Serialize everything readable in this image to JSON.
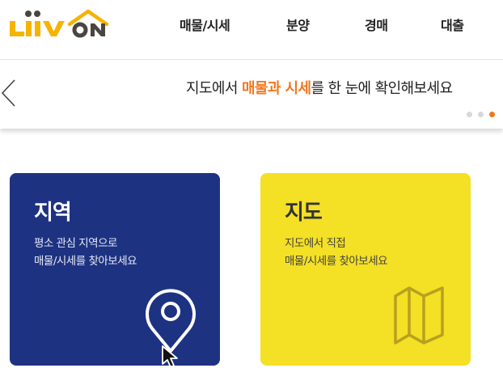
{
  "header": {
    "logo_text": "LiiV ON",
    "nav": [
      "매물/시세",
      "분양",
      "경매",
      "대출"
    ]
  },
  "banner": {
    "text_before": "지도에서 ",
    "text_highlight": "매물과 시세",
    "text_after": "를 한 눈에 확인해보세요",
    "slide_count": 3,
    "active_slide": 3
  },
  "cards": [
    {
      "title": "지역",
      "desc_line1": "평소 관심 지역으로",
      "desc_line2": "매물/시세를 찾아보세요",
      "icon": "location-pin-icon"
    },
    {
      "title": "지도",
      "desc_line1": "지도에서 직접",
      "desc_line2": "매물/시세를 찾아보세요",
      "icon": "folded-map-icon"
    }
  ],
  "colors": {
    "accent": "#f07820",
    "region_card": "#1e3282",
    "map_card": "#f4e024",
    "logo_yellow": "#f4b400",
    "logo_dark": "#4a4540"
  }
}
